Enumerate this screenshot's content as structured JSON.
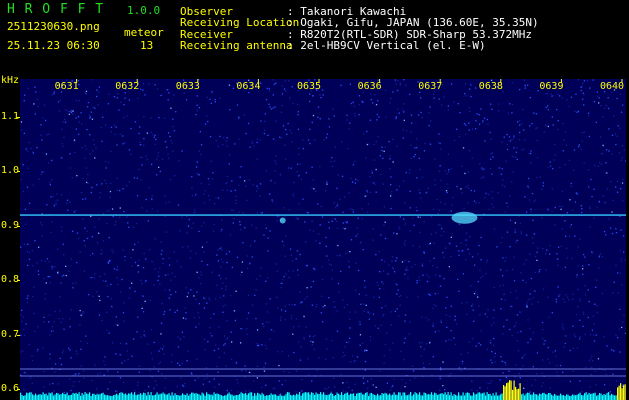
{
  "header": {
    "app_title": "H R O F F T",
    "app_version": "1.0.0",
    "filename": "2511230630.png",
    "datetime": "25.11.23 06:30",
    "meteor_label": "meteor",
    "meteor_count": "13",
    "rows": [
      {
        "label": "Observer",
        "value": ": Takanori Kawachi"
      },
      {
        "label": "Receiving Location",
        "value": ": Ogaki, Gifu, JAPAN (136.60E, 35.35N)"
      },
      {
        "label": "Receiver",
        "value": ": R820T2(RTL-SDR) SDR-Sharp 53.372MHz"
      },
      {
        "label": "Receiving antenna",
        "value": ": 2el-HB9CV Vertical (el. E-W)"
      }
    ]
  },
  "colors": {
    "background": "#000000",
    "plot_background": "#000058",
    "label_yellow": "#ffff00",
    "title_green": "#22dd22",
    "carrier_cyan": "#33ccff",
    "noise_bars": "#00ffff",
    "noise_peak": "#ffff00"
  },
  "chart_data": {
    "type": "heatmap",
    "yunit": "kHz",
    "yticks": [
      "1.1",
      "1.0",
      "0.9",
      "0.8",
      "0.7",
      "0.6"
    ],
    "y_values": [
      1.1,
      1.0,
      0.9,
      0.8,
      0.7,
      0.6
    ],
    "ylim": [
      0.58,
      1.17
    ],
    "xticks": [
      "0631",
      "0632",
      "0633",
      "0634",
      "0635",
      "0636",
      "0637",
      "0638",
      "0639",
      "0640"
    ],
    "carrier_khz": 0.92,
    "meteor_events": [
      {
        "time": "0635",
        "freq_khz": 0.91
      },
      {
        "time": "0638",
        "freq_khz": 0.915
      }
    ]
  }
}
